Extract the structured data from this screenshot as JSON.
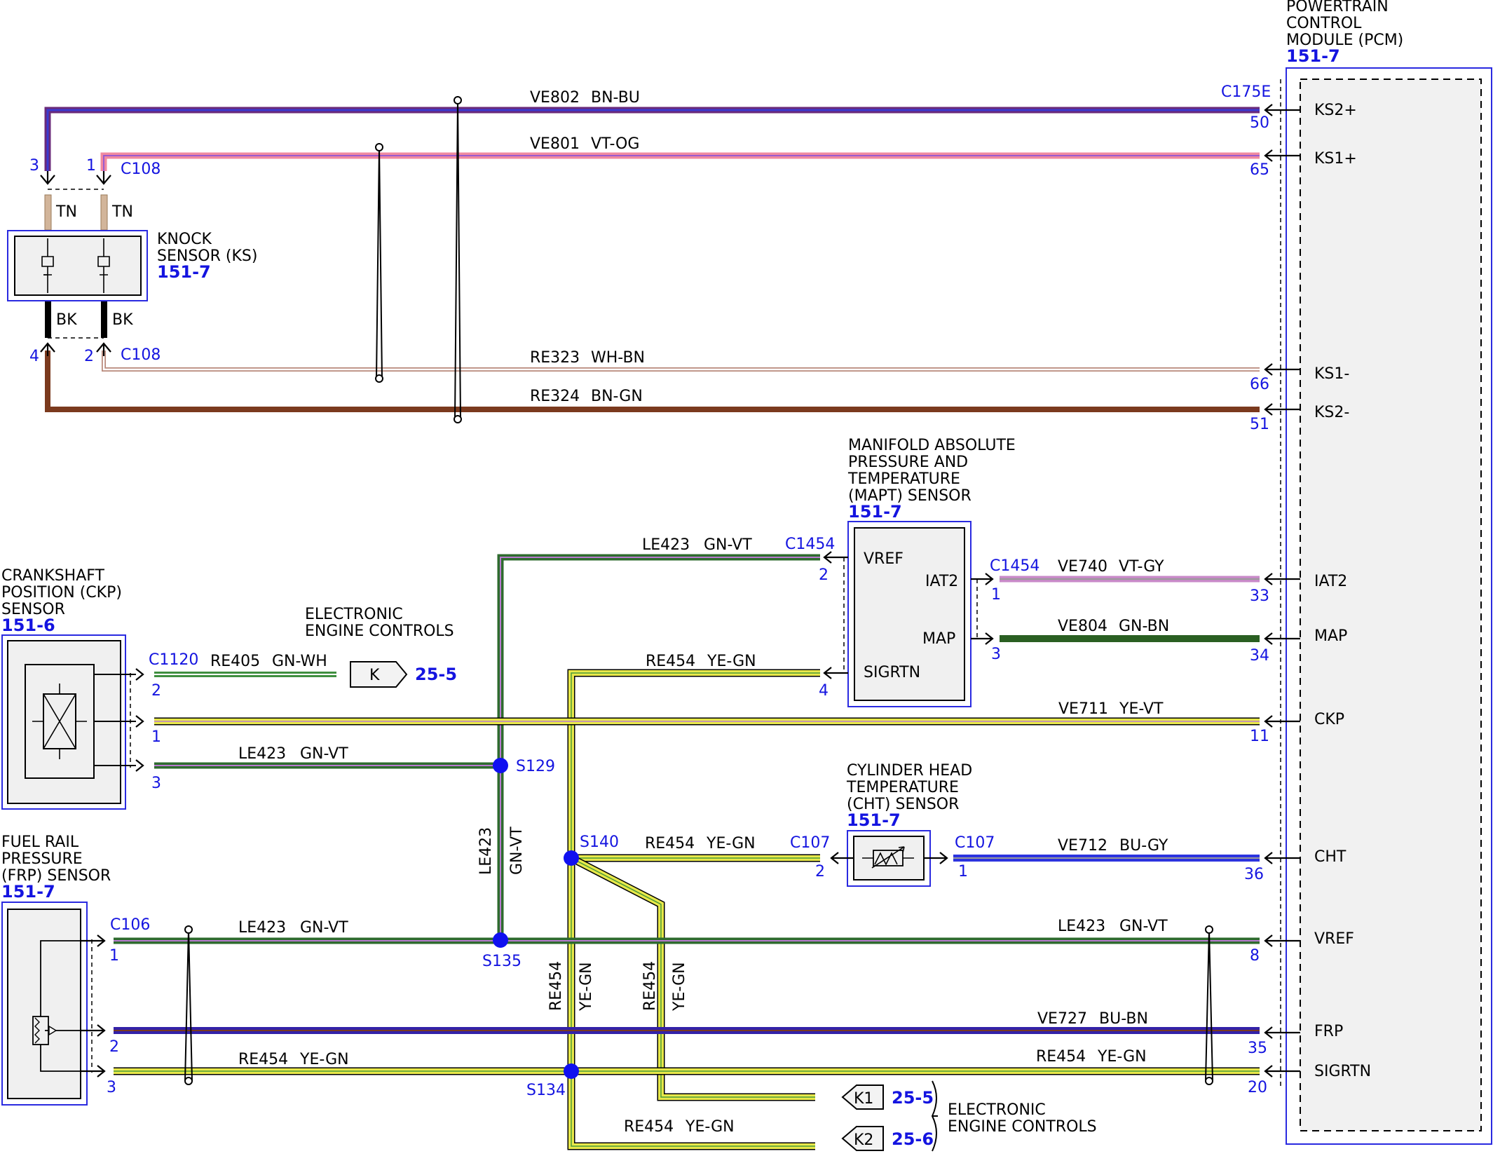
{
  "colors": {
    "brown_blue": "#6a2a7a",
    "violet_orange": "#f08aa0",
    "white_brown": "#c9a99a",
    "brown_green": "#7b3a1e",
    "green_violet": "#2e6b2e",
    "green_white": "#3f8f3f",
    "yellow": "#e8e84a",
    "violet_grey": "#c88ac8",
    "green_brown": "#2a5f22",
    "blue_grey": "#2b33e0",
    "blue_brown": "#3321a8",
    "tan": "#d2b59a",
    "black": "#000000",
    "reference_blue": "#1414e0"
  },
  "pcm": {
    "title_lines": [
      "POWERTRAIN",
      "CONTROL",
      "MODULE (PCM)"
    ],
    "ref": "151-7",
    "connector": "C175E",
    "pins": [
      {
        "label": "KS2+",
        "pin": "50"
      },
      {
        "label": "KS1+",
        "pin": "65"
      },
      {
        "label": "KS1-",
        "pin": "66"
      },
      {
        "label": "KS2-",
        "pin": "51"
      },
      {
        "label": "IAT2",
        "pin": "33"
      },
      {
        "label": "MAP",
        "pin": "34"
      },
      {
        "label": "CKP",
        "pin": "11"
      },
      {
        "label": "CHT",
        "pin": "36"
      },
      {
        "label": "VREF",
        "pin": "8"
      },
      {
        "label": "FRP",
        "pin": "35"
      },
      {
        "label": "SIGRTN",
        "pin": "20"
      }
    ]
  },
  "knock_sensor": {
    "title_lines": [
      "KNOCK",
      "SENSOR (KS)"
    ],
    "ref": "151-7",
    "connector": "C108",
    "pins": [
      "3",
      "1",
      "4",
      "2"
    ],
    "lead_top": "TN",
    "lead_bottom": "BK"
  },
  "mapt_sensor": {
    "title_lines": [
      "MANIFOLD ABSOLUTE",
      "PRESSURE AND",
      "TEMPERATURE",
      "(MAPT) SENSOR"
    ],
    "ref": "151-7",
    "connector": "C1454",
    "pins_left": {
      "vref": "2",
      "sigrtn": "4"
    },
    "pins_right": {
      "iat2": "1",
      "map": "3"
    },
    "labels": {
      "vref": "VREF",
      "iat2": "IAT2",
      "map": "MAP",
      "sigrtn": "SIGRTN"
    }
  },
  "ckp_sensor": {
    "title_lines": [
      "CRANKSHAFT",
      "POSITION (CKP)",
      "SENSOR"
    ],
    "ref": "151-6",
    "connector": "C1120",
    "pins": [
      "2",
      "1",
      "3"
    ]
  },
  "cht_sensor": {
    "title_lines": [
      "CYLINDER HEAD",
      "TEMPERATURE",
      "(CHT) SENSOR"
    ],
    "ref": "151-7",
    "connector": "C107",
    "pins": [
      "2",
      "1"
    ]
  },
  "frp_sensor": {
    "title_lines": [
      "FUEL RAIL",
      "PRESSURE",
      "(FRP) SENSOR"
    ],
    "ref": "151-7",
    "connector": "C106",
    "pins": [
      "1",
      "2",
      "3"
    ]
  },
  "eec_top": {
    "title_lines": [
      "ELECTRONIC",
      "ENGINE CONTROLS"
    ],
    "tag": "K",
    "ref": "25-5"
  },
  "eec_bottom": {
    "title_lines": [
      "ELECTRONIC",
      "ENGINE CONTROLS"
    ],
    "tags": [
      {
        "tag": "K1",
        "ref": "25-5"
      },
      {
        "tag": "K2",
        "ref": "25-6"
      }
    ]
  },
  "splices": [
    "S129",
    "S135",
    "S140",
    "S134"
  ],
  "wires": {
    "ve802": {
      "circuit": "VE802",
      "color": "BN-BU"
    },
    "ve801": {
      "circuit": "VE801",
      "color": "VT-OG"
    },
    "re323": {
      "circuit": "RE323",
      "color": "WH-BN"
    },
    "re324": {
      "circuit": "RE324",
      "color": "BN-GN"
    },
    "le423_mapt": {
      "circuit": "LE423",
      "color": "GN-VT"
    },
    "ve740": {
      "circuit": "VE740",
      "color": "VT-GY"
    },
    "ve804": {
      "circuit": "VE804",
      "color": "GN-BN"
    },
    "re454_mapt": {
      "circuit": "RE454",
      "color": "YE-GN"
    },
    "re405": {
      "circuit": "RE405",
      "color": "GN-WH"
    },
    "ve711": {
      "circuit": "VE711",
      "color": "YE-VT"
    },
    "le423_ckp": {
      "circuit": "LE423",
      "color": "GN-VT"
    },
    "le423_vert": {
      "circuit": "LE423",
      "color": "GN-VT"
    },
    "re454_cht": {
      "circuit": "RE454",
      "color": "YE-GN"
    },
    "ve712": {
      "circuit": "VE712",
      "color": "BU-GY"
    },
    "le423_frp": {
      "circuit": "LE423",
      "color": "GN-VT"
    },
    "le423_pcm": {
      "circuit": "LE423",
      "color": "GN-VT"
    },
    "re454_v1": {
      "circuit": "RE454",
      "color": "YE-GN"
    },
    "re454_v2": {
      "circuit": "RE454",
      "color": "YE-GN"
    },
    "ve727": {
      "circuit": "VE727",
      "color": "BU-BN"
    },
    "re454_frp": {
      "circuit": "RE454",
      "color": "YE-GN"
    },
    "re454_pcm": {
      "circuit": "RE454",
      "color": "YE-GN"
    },
    "re454_k2": {
      "circuit": "RE454",
      "color": "YE-GN"
    }
  }
}
